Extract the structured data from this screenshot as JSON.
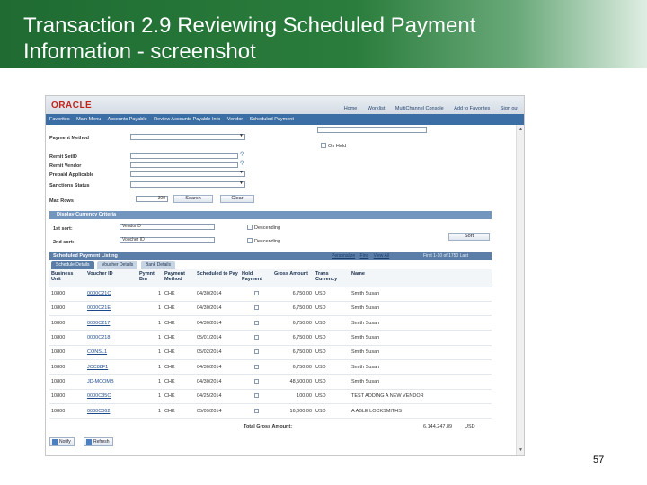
{
  "slide": {
    "title_line1": "Transaction 2.9 Reviewing Scheduled Payment",
    "title_line2": "Information - screenshot",
    "page_number": "57"
  },
  "app": {
    "logo": "ORACLE",
    "breadcrumb": [
      "Favorites",
      "Main Menu",
      "Accounts Payable",
      "Review Accounts Payable Info",
      "Vendor",
      "Scheduled Payment"
    ],
    "top_links": [
      "Home",
      "Worklist",
      "MultiChannel Console",
      "Add to Favorites",
      "Sign out"
    ]
  },
  "form": {
    "payment_method_label": "Payment Method",
    "on_hold_label": "On Hold",
    "remit_setid_label": "Remit SetID",
    "remit_vendor_label": "Remit Vendor",
    "prepaid_applicable_label": "Prepaid Applicable",
    "sanctions_status_label": "Sanctions Status",
    "max_rows_label": "Max Rows",
    "max_rows_value": "300",
    "search_button": "Search",
    "clear_button": "Clear",
    "display_criteria_label": "Display Currency Criteria",
    "first_sort_label": "1st sort:",
    "first_sort_value": "VendorID",
    "second_sort_label": "2nd sort:",
    "second_sort_value": "Voucher ID",
    "descending_label_1": "Descending",
    "descending_label_2": "Descending",
    "sort_button": "Sort"
  },
  "grid": {
    "title": "Scheduled Payment Listing",
    "links": [
      "Personalize",
      "Find",
      "View All"
    ],
    "pager": "First  1-10 of 1750  Last",
    "tabs": [
      "Schedule Details",
      "Voucher Details",
      "Bank Details"
    ],
    "columns": [
      "Business Unit",
      "Voucher ID",
      "Pymnt Bnr",
      "Payment Method",
      "Scheduled to Pay",
      "Hold Payment",
      "Gross Amount",
      "Trans Currency",
      "Name"
    ],
    "rows": [
      [
        "10800",
        "0000C21C",
        "1",
        "CHK",
        "04/30/2014",
        "6,750.00",
        "USD",
        "Smith Susan"
      ],
      [
        "10800",
        "0000C21E",
        "1",
        "CHK",
        "04/30/2014",
        "6,750.00",
        "USD",
        "Smith Susan"
      ],
      [
        "10800",
        "0000C217",
        "1",
        "CHK",
        "04/30/2014",
        "6,750.00",
        "USD",
        "Smith Susan"
      ],
      [
        "10800",
        "0000C218",
        "1",
        "CHK",
        "05/01/2014",
        "6,750.00",
        "USD",
        "Smith Susan"
      ],
      [
        "10800",
        "CONSL1",
        "1",
        "CHK",
        "05/02/2014",
        "6,750.00",
        "USD",
        "Smith Susan"
      ],
      [
        "10800",
        "JCC88F1",
        "1",
        "CHK",
        "04/30/2014",
        "6,750.00",
        "USD",
        "Smith Susan"
      ],
      [
        "10800",
        "JD-MCOMB",
        "1",
        "CHK",
        "04/30/2014",
        "48,500.00",
        "USD",
        "Smith Susan"
      ],
      [
        "10800",
        "0000C35C",
        "1",
        "CHK",
        "04/25/2014",
        "100.00",
        "USD",
        "TEST ADDING A NEW VENDOR"
      ],
      [
        "10800",
        "0000C062",
        "1",
        "CHK",
        "05/09/2014",
        "16,000.00",
        "USD",
        "A ABLE LOCKSMITHS"
      ]
    ],
    "total_label": "Total Gross Amount:",
    "total_value": "6,144,247.89",
    "total_currency": "USD"
  },
  "footer": {
    "notify_button": "Notify",
    "refresh_button": "Refresh"
  }
}
